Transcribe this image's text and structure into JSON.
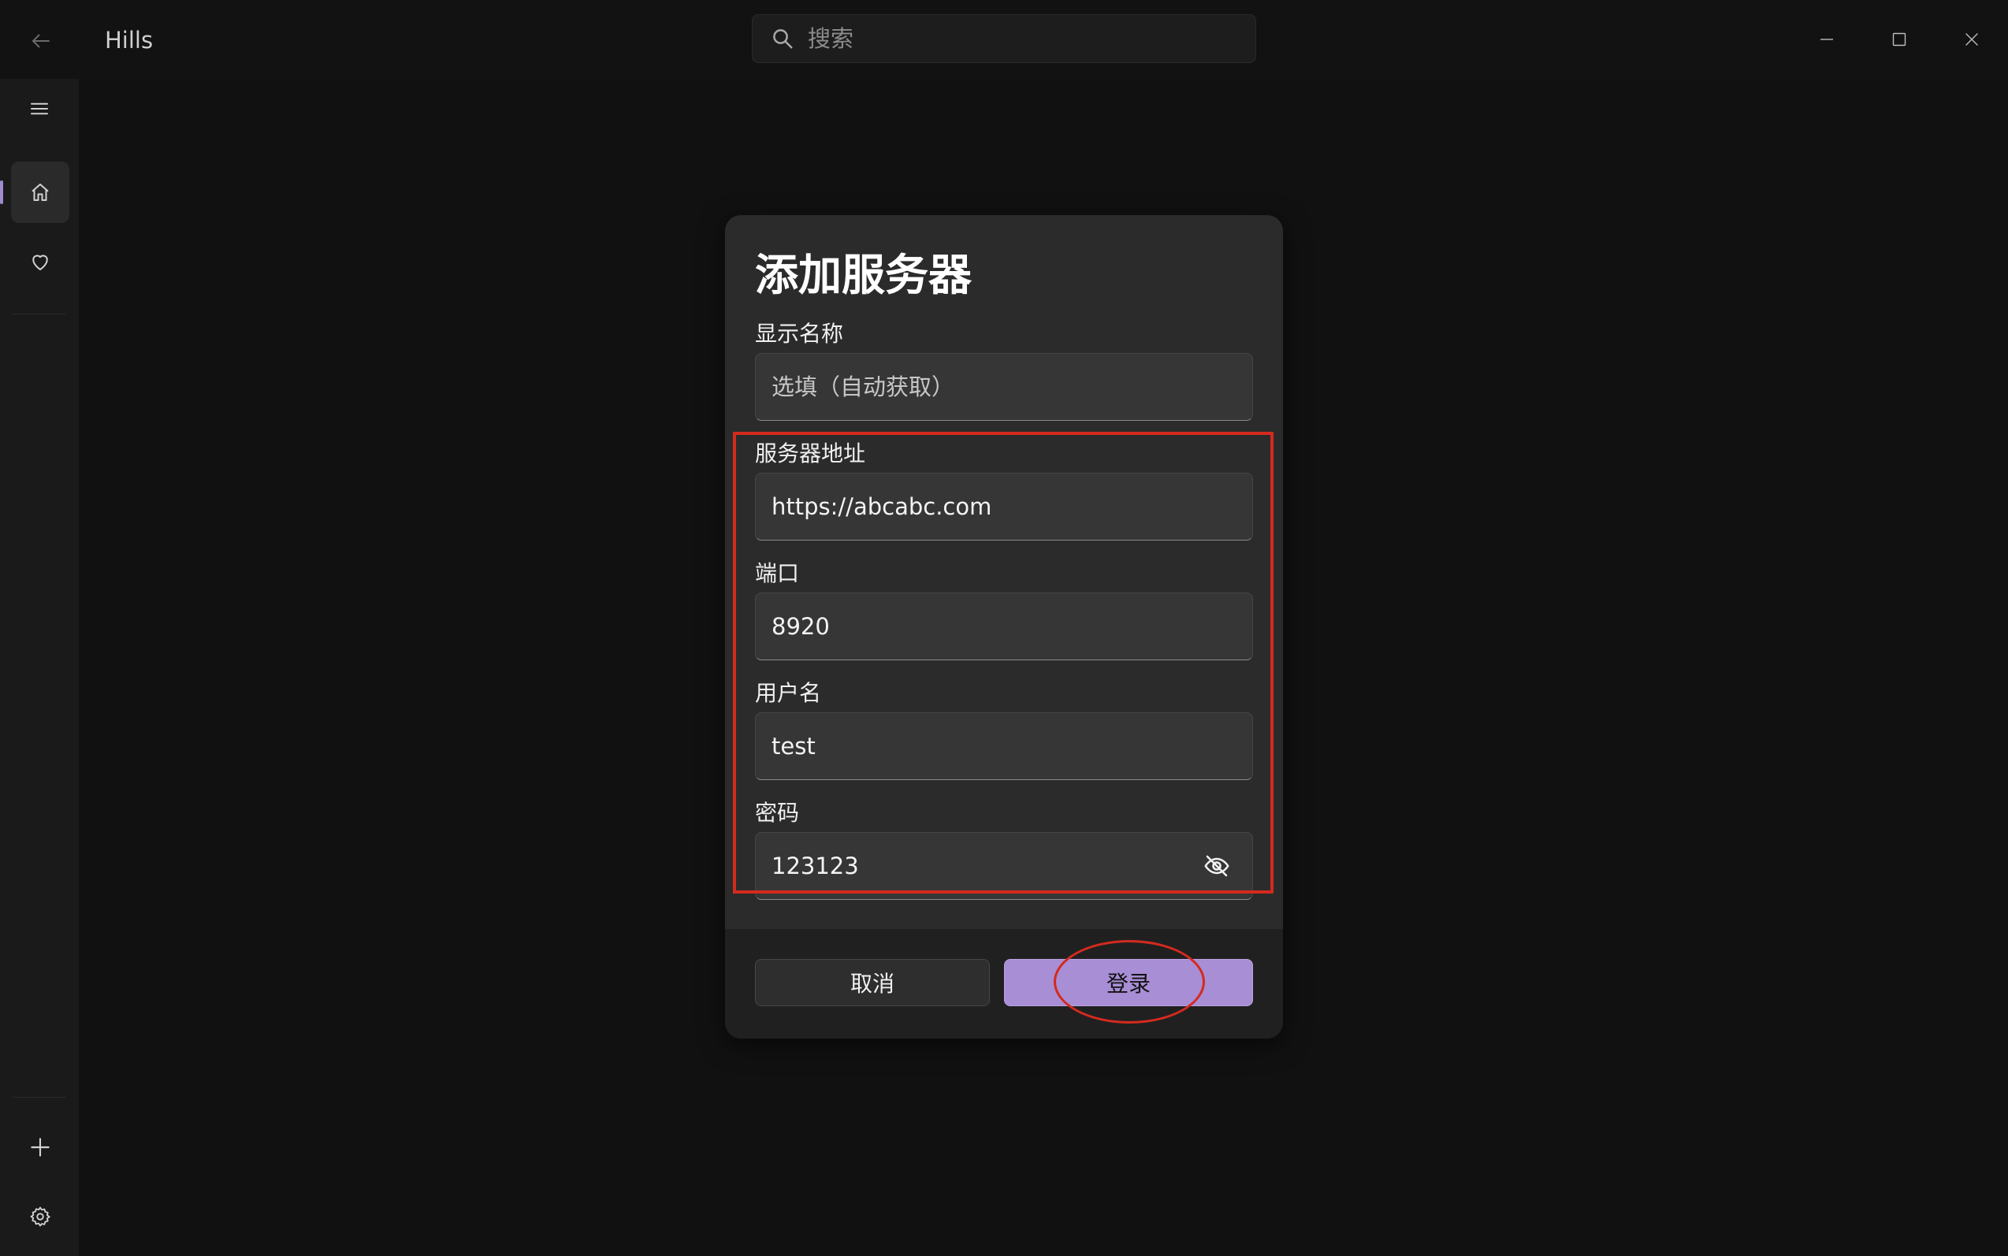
{
  "window": {
    "title": "Hills",
    "search_placeholder": "搜索"
  },
  "dialog": {
    "title": "添加服务器",
    "fields": [
      {
        "label": "显示名称",
        "value": "",
        "placeholder": "选填（自动获取）"
      },
      {
        "label": "服务器地址",
        "value": "https://abcabc.com",
        "placeholder": ""
      },
      {
        "label": "端口",
        "value": "8920",
        "placeholder": ""
      },
      {
        "label": "用户名",
        "value": "test",
        "placeholder": ""
      },
      {
        "label": "密码",
        "value": "123123",
        "placeholder": ""
      }
    ],
    "buttons": {
      "cancel": "取消",
      "login": "登录"
    }
  },
  "colors": {
    "accent": "#a88ed5",
    "annotation": "#d42a1e",
    "background": "#111111",
    "dialog_background": "#2b2b2b"
  },
  "icons": {
    "back": "arrow-left-icon",
    "search": "search-icon",
    "minimize": "minimize-icon",
    "maximize": "maximize-icon",
    "close": "close-icon",
    "menu": "hamburger-icon",
    "home": "home-icon",
    "favorites": "heart-icon",
    "add": "plus-icon",
    "settings": "gear-icon",
    "password_toggle": "eye-off-icon"
  }
}
